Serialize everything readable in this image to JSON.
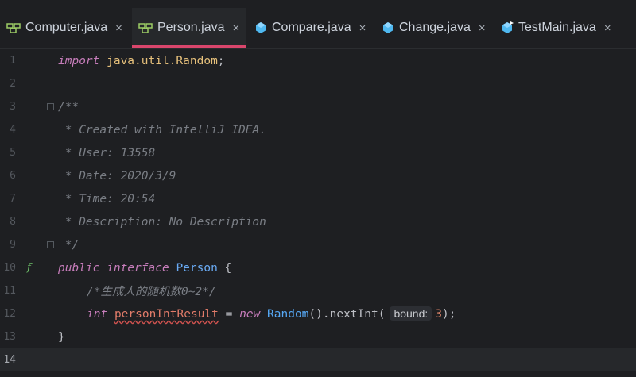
{
  "tabs": [
    {
      "label": "Computer.java",
      "icon": "interface-icon",
      "active": false
    },
    {
      "label": "Person.java",
      "icon": "interface-icon",
      "active": true
    },
    {
      "label": "Compare.java",
      "icon": "class-icon",
      "active": false
    },
    {
      "label": "Change.java",
      "icon": "class-icon",
      "active": false
    },
    {
      "label": "TestMain.java",
      "icon": "main-class-icon",
      "active": false
    }
  ],
  "close_glyph": "×",
  "code": {
    "line_numbers": [
      "1",
      "2",
      "3",
      "4",
      "5",
      "6",
      "7",
      "8",
      "9",
      "10",
      "11",
      "12",
      "13",
      "14"
    ],
    "l1": {
      "kw": "import",
      "pkg": " java.util.Random",
      "punct": ";"
    },
    "l3": "/**",
    "l4": " * Created with IntelliJ IDEA.",
    "l5": " * User: 13558",
    "l6": " * Date: 2020/3/9",
    "l7": " * Time: 20:54",
    "l8": " * Description: No Description",
    "l9": " */",
    "l10": {
      "kw1": "public",
      "kw2": "interface",
      "name": "Person",
      "brace": " {"
    },
    "l11": "/*生成人的随机数0~2*/",
    "l12": {
      "kw": "int",
      "var": "personIntResult",
      "eq": " = ",
      "new": "new",
      "cls": "Random",
      "call": "().nextInt(",
      "hint": "bound:",
      "num": "3",
      "end": ");"
    },
    "l13": "}"
  },
  "colors": {
    "accent": "#d9466c",
    "background": "#1e1f22"
  }
}
